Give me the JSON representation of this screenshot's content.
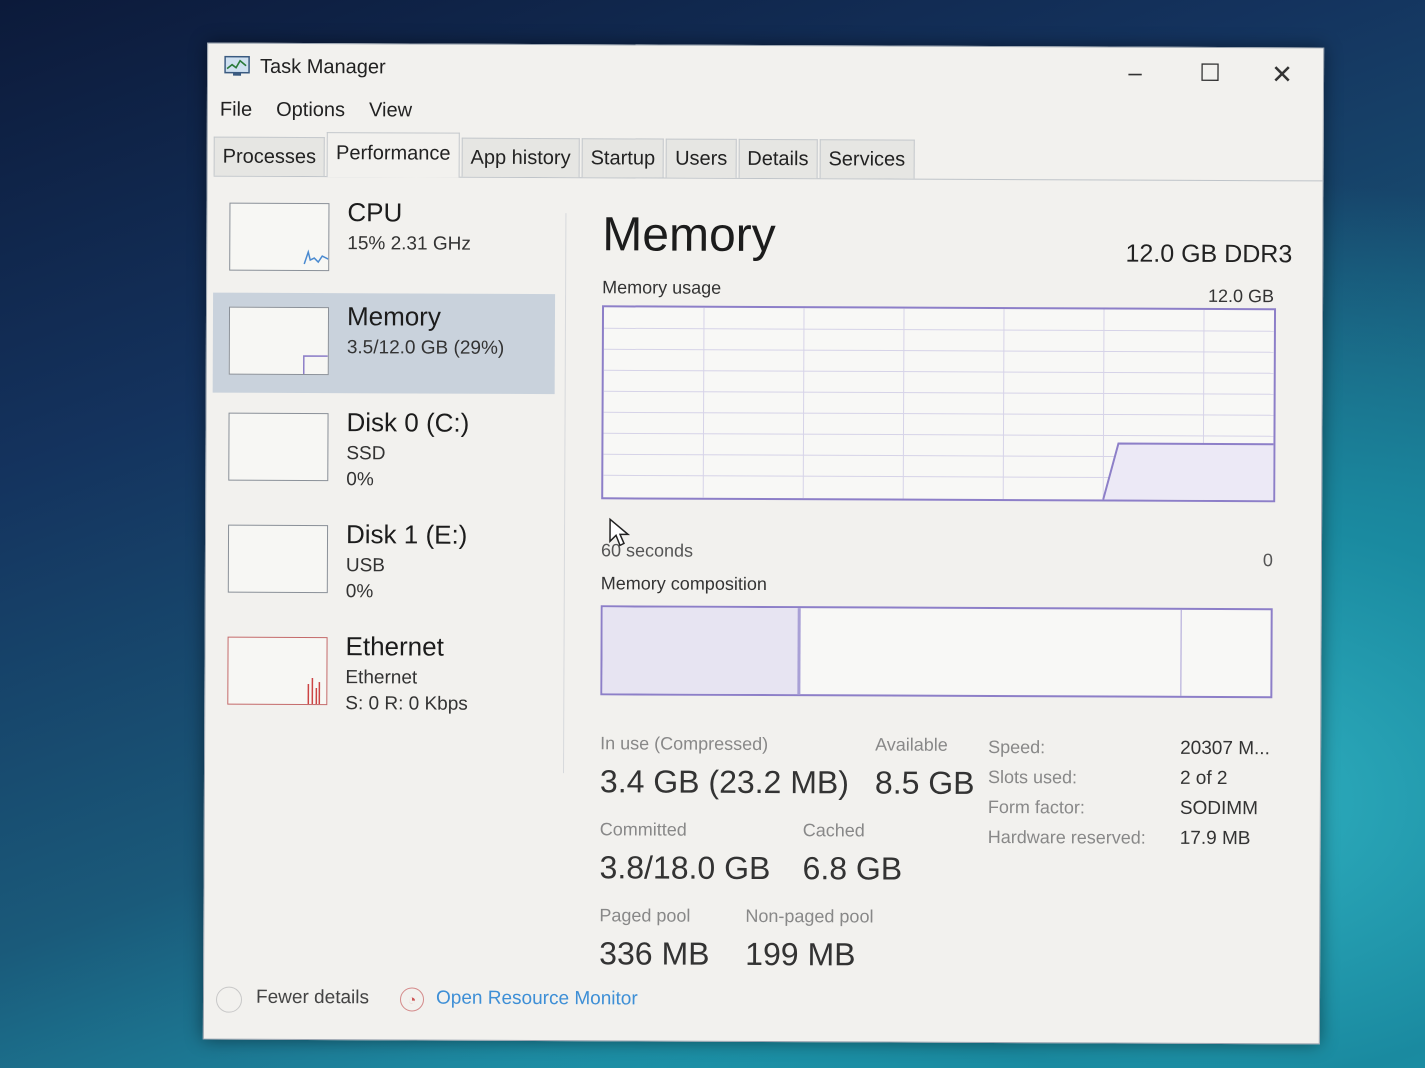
{
  "window": {
    "title": "Task Manager"
  },
  "controls": {
    "minimize": "–",
    "maximize": "☐",
    "close": "✕"
  },
  "menu": [
    "File",
    "Options",
    "View"
  ],
  "tabs": [
    "Processes",
    "Performance",
    "App history",
    "Startup",
    "Users",
    "Details",
    "Services"
  ],
  "active_tab": "Performance",
  "sidebar": {
    "cpu": {
      "name": "CPU",
      "detail": "15% 2.31 GHz"
    },
    "memory": {
      "name": "Memory",
      "detail": "3.5/12.0 GB (29%)"
    },
    "disk0": {
      "name": "Disk 0 (C:)",
      "type": "SSD",
      "usage": "0%"
    },
    "disk1": {
      "name": "Disk 1 (E:)",
      "type": "USB",
      "usage": "0%"
    },
    "ethernet": {
      "name": "Ethernet",
      "type": "Ethernet",
      "rate": "S: 0 R: 0 Kbps"
    }
  },
  "main": {
    "title": "Memory",
    "spec": "12.0 GB DDR3",
    "usage_label": "Memory usage",
    "usage_max": "12.0 GB",
    "time_label": "60 seconds",
    "time_zero": "0",
    "composition_label": "Memory composition"
  },
  "stats": {
    "in_use_label": "In use (Compressed)",
    "in_use_value": "3.4 GB (23.2 MB)",
    "available_label": "Available",
    "available_value": "8.5 GB",
    "committed_label": "Committed",
    "committed_value": "3.8/18.0 GB",
    "cached_label": "Cached",
    "cached_value": "6.8 GB",
    "paged_label": "Paged pool",
    "paged_value": "336 MB",
    "nonpaged_label": "Non-paged pool",
    "nonpaged_value": "199 MB"
  },
  "specs": {
    "speed_label": "Speed:",
    "speed_value": "20307 M...",
    "slots_label": "Slots used:",
    "slots_value": "2 of 2",
    "form_label": "Form factor:",
    "form_value": "SODIMM",
    "hw_label": "Hardware reserved:",
    "hw_value": "17.9 MB"
  },
  "footer": {
    "fewer_details": "Fewer details",
    "resource_monitor": "Open Resource Monitor"
  },
  "colors": {
    "memory_accent": "#8d7fc8",
    "selected_bg": "#c9d2dc",
    "link": "#3e8fd6",
    "ethernet_accent": "#c44"
  }
}
